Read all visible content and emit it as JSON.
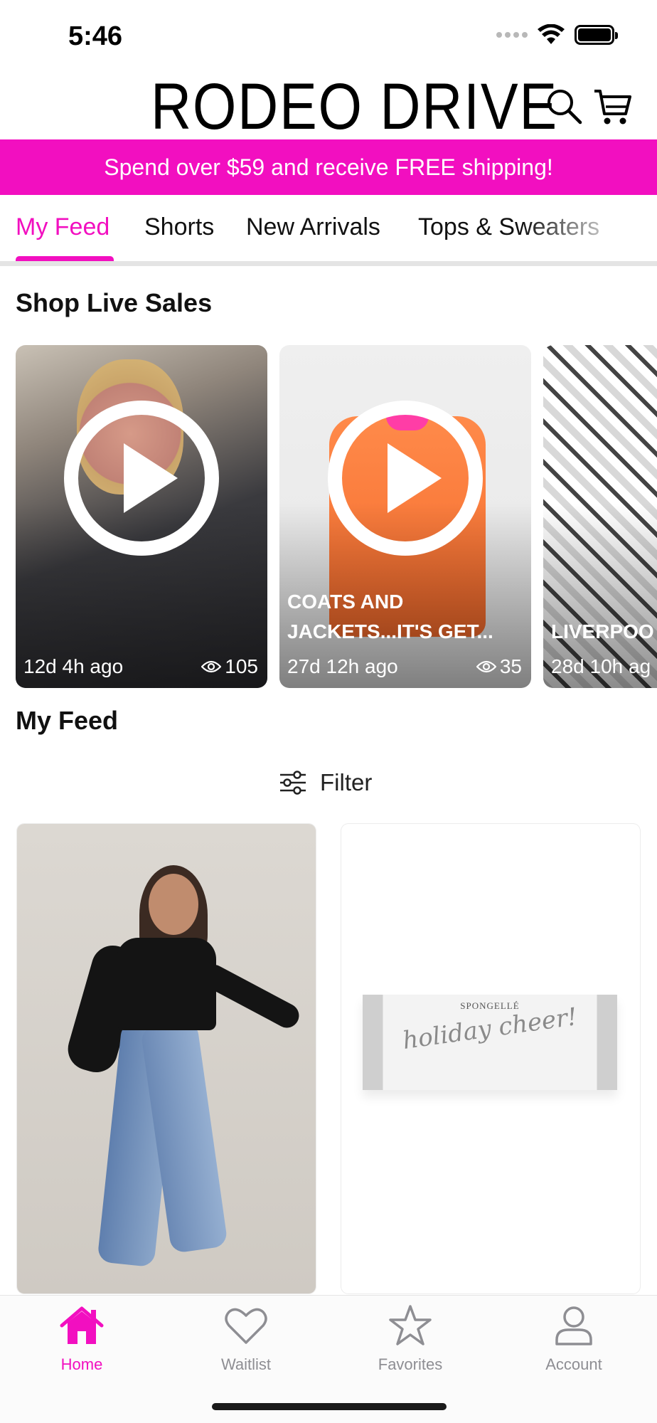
{
  "status_bar": {
    "time": "5:46",
    "icons": [
      "signal-icon",
      "wifi-icon",
      "battery-icon"
    ]
  },
  "header": {
    "logo": "RODEO DRIVE",
    "icons": [
      "search-icon",
      "cart-icon"
    ]
  },
  "promo_banner": {
    "text": "Spend over $59 and receive FREE shipping!",
    "color": "#f20fc0"
  },
  "tabs": [
    {
      "label": "My Feed",
      "active": true
    },
    {
      "label": "Shorts",
      "active": false
    },
    {
      "label": "New Arrivals",
      "active": false
    },
    {
      "label": "Tops & Sweaters",
      "active": false
    }
  ],
  "live_section": {
    "title": "Shop Live Sales",
    "cards": [
      {
        "title": "",
        "ago": "12d 4h ago",
        "views": "105"
      },
      {
        "title": "COATS AND JACKETS...IT'S GET...",
        "ago": "27d 12h ago",
        "views": "35"
      },
      {
        "title": "LIVERPOO",
        "ago": "28d 10h ag",
        "views": ""
      }
    ]
  },
  "feed_section": {
    "title": "My Feed",
    "filter_label": "Filter",
    "product_brand": "SPONGELLÉ",
    "product_script": "holiday cheer!"
  },
  "bottom_nav": [
    {
      "label": "Home",
      "icon": "home-icon",
      "active": true
    },
    {
      "label": "Waitlist",
      "icon": "heart-icon",
      "active": false
    },
    {
      "label": "Favorites",
      "icon": "star-icon",
      "active": false
    },
    {
      "label": "Account",
      "icon": "person-icon",
      "active": false
    }
  ],
  "colors": {
    "accent": "#f20fc0",
    "inactive": "#8e8e93",
    "text": "#111111"
  }
}
